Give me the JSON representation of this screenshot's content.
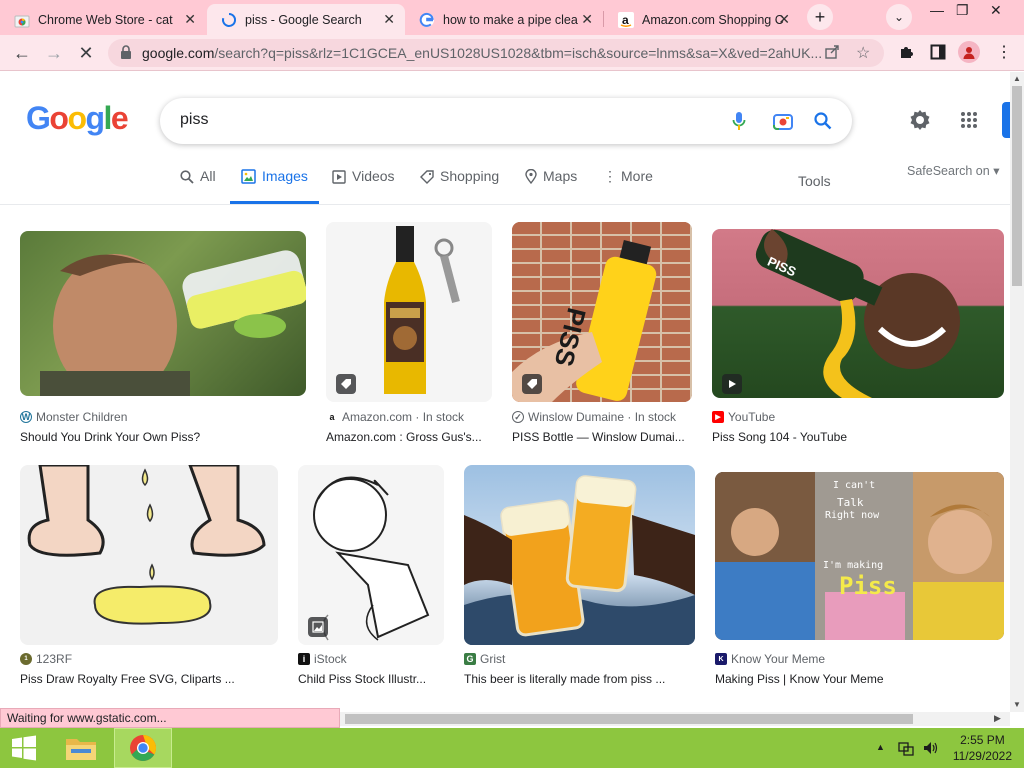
{
  "browser": {
    "tabs": [
      {
        "title": "Chrome Web Store - cat",
        "favicon": "chrome-web-store-icon"
      },
      {
        "title": "piss - Google Search",
        "favicon": "loading-spinner-icon",
        "active": true
      },
      {
        "title": "how to make a pipe clea",
        "favicon": "google-g-icon"
      },
      {
        "title": "Amazon.com Shopping C",
        "favicon": "amazon-icon"
      }
    ],
    "url_domain": "google.com",
    "url_rest": "/search?q=piss&rlz=1C1GCEA_enUS1028US1028&tbm=isch&source=lnms&sa=X&ved=2ahUK..."
  },
  "search": {
    "query": "piss",
    "logo": "Google"
  },
  "filters": {
    "all": "All",
    "images": "Images",
    "videos": "Videos",
    "shopping": "Shopping",
    "maps": "Maps",
    "more": "More",
    "tools": "Tools",
    "safesearch": "SafeSearch on"
  },
  "results": [
    {
      "source": "Monster Children",
      "caption": "Should You Drink Your Own Piss?",
      "icon": "wordpress-icon"
    },
    {
      "source": "Amazon.com · In stock",
      "caption": "Amazon.com : Gross Gus's...",
      "icon": "amazon-icon",
      "badge": "product-tag-icon"
    },
    {
      "source": "Winslow Dumaine · In stock",
      "caption": "PISS Bottle — Winslow Dumai...",
      "icon": "winslow-icon",
      "badge": "product-tag-icon",
      "label": "PISS"
    },
    {
      "source": "YouTube",
      "caption": "Piss Song 104 - YouTube",
      "icon": "youtube-icon",
      "badge": "play-icon",
      "label": "PISS"
    },
    {
      "source": "123RF",
      "caption": "Piss Draw Royalty Free SVG, Cliparts ...",
      "icon": "123rf-icon"
    },
    {
      "source": "iStock",
      "caption": "Child Piss Stock Illustr...",
      "icon": "istock-icon",
      "badge": "image-icon"
    },
    {
      "source": "Grist",
      "caption": "This beer is literally made from piss ...",
      "icon": "grist-icon"
    },
    {
      "source": "Know Your Meme",
      "caption": "Making Piss | Know Your Meme",
      "icon": "kym-icon",
      "label1": "I can't",
      "label2": "Talk",
      "label3": "Right now",
      "label4": "I'm making",
      "label5": "Piss"
    }
  ],
  "status": "Waiting for www.gstatic.com...",
  "taskbar": {
    "time": "2:55 PM",
    "date": "11/29/2022"
  },
  "colors": {
    "accent": "#1a73e8",
    "tabstrip": "#ffc9d4",
    "taskbar": "#8dc63f"
  }
}
